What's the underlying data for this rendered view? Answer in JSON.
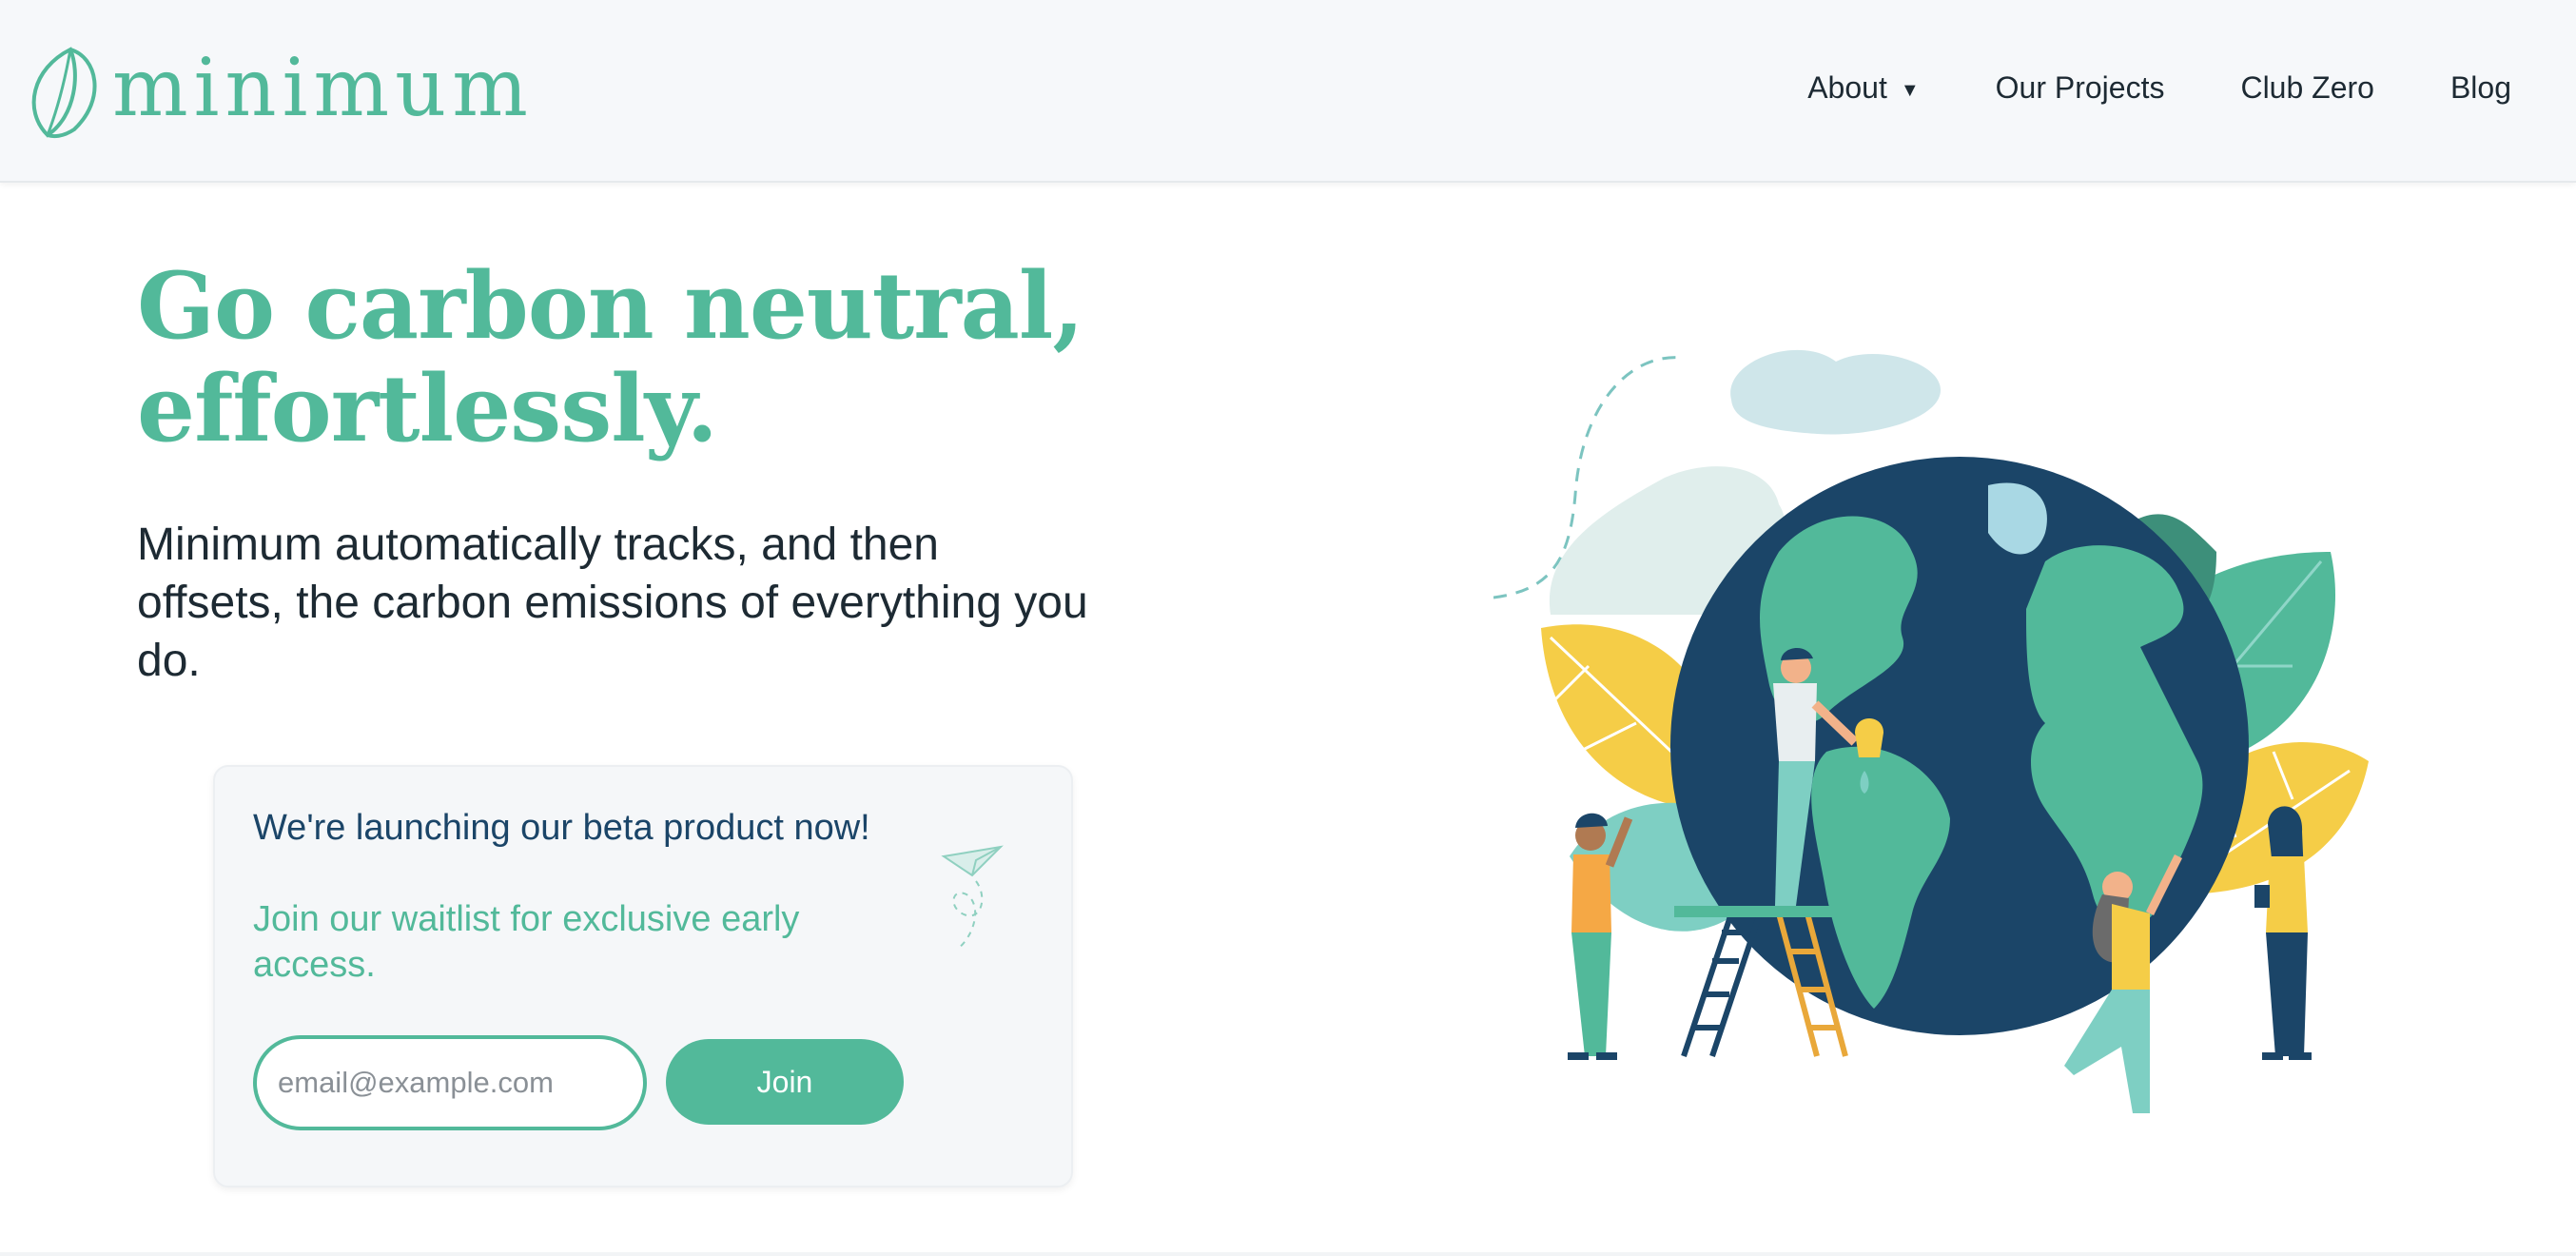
{
  "brand": {
    "name": "minimum",
    "accent_color": "#52b99a",
    "navy_color": "#1b4568",
    "yellow_color": "#f5cd47"
  },
  "nav": {
    "items": [
      {
        "label": "About",
        "has_dropdown": true,
        "icon": "caret-down-icon"
      },
      {
        "label": "Our Projects"
      },
      {
        "label": "Club Zero"
      },
      {
        "label": "Blog"
      }
    ]
  },
  "hero": {
    "title_line1": "Go carbon neutral,",
    "title_line2": "effortlessly.",
    "subtitle": "Minimum automatically tracks, and then offsets, the carbon emissions of everything you do."
  },
  "waitlist": {
    "line1": "We're launching our beta product now!",
    "line2": "Join our waitlist for exclusive early access.",
    "email_placeholder": "email@example.com",
    "email_value": "",
    "button_label": "Join",
    "decor_icon": "paper-plane-icon"
  },
  "illustration": {
    "subject": "earth-globe-with-people-illustration"
  }
}
